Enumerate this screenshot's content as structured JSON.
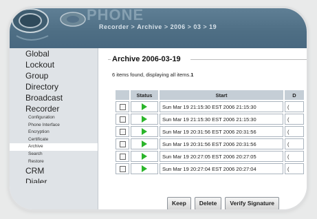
{
  "header": {
    "brand": "PHONE",
    "breadcrumb": [
      "Recorder",
      "Archive",
      "2006",
      "03",
      "19"
    ],
    "breadcrumb_sep": ">"
  },
  "sidebar": {
    "top_items": [
      "Global",
      "Lockout",
      "Group",
      "Directory",
      "Broadcast",
      "Recorder"
    ],
    "sub_items": [
      "Configuration",
      "Phone Interface",
      "Encryption",
      "Certificate",
      "Archive",
      "Search",
      "Restore"
    ],
    "active_sub": "Archive",
    "bottom_items": [
      "CRM",
      "Dialer"
    ]
  },
  "main": {
    "title": "Archive 2006-03-19",
    "found_text": "6 items found, displaying all items.",
    "page_number": "1",
    "columns": [
      "",
      "Status",
      "Start",
      "D"
    ],
    "rows": [
      {
        "start": "Sun Mar 19 21:15:30 EST 2006 21:15:30",
        "d": "("
      },
      {
        "start": "Sun Mar 19 21:15:30 EST 2006 21:15:30",
        "d": "("
      },
      {
        "start": "Sun Mar 19 20:31:56 EST 2006 20:31:56",
        "d": "("
      },
      {
        "start": "Sun Mar 19 20:31:56 EST 2006 20:31:56",
        "d": "("
      },
      {
        "start": "Sun Mar 19 20:27:05 EST 2006 20:27:05",
        "d": "("
      },
      {
        "start": "Sun Mar 19 20:27:04 EST 2006 20:27:04",
        "d": "("
      }
    ],
    "buttons": {
      "keep": "Keep",
      "delete": "Delete",
      "verify": "Verify Signature"
    }
  },
  "colors": {
    "header": "#537389",
    "sidebar": "#dfe3e7",
    "play": "#2bb52b"
  },
  "icons": {
    "status": "play-icon",
    "logo": "phone-logo-icon"
  }
}
